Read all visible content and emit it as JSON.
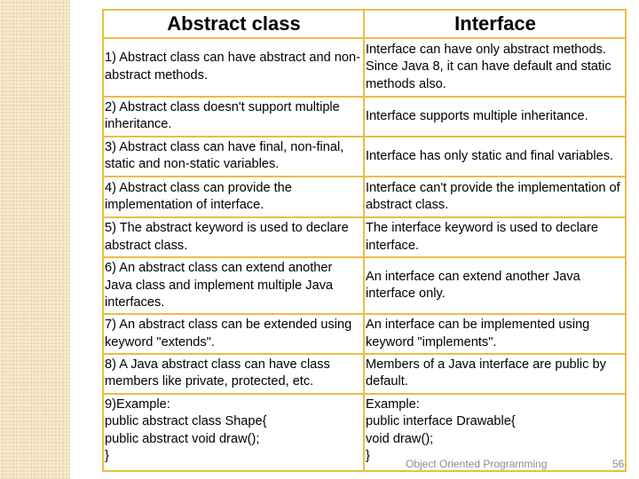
{
  "table": {
    "headers": [
      "Abstract class",
      "Interface"
    ],
    "rows": [
      {
        "abstract": "1) Abstract class can have abstract and non-abstract methods.",
        "interface": "Interface can have only abstract methods. Since Java 8, it can have default and static methods also."
      },
      {
        "abstract": "2) Abstract class doesn't support multiple inheritance.",
        "interface": "Interface supports multiple inheritance."
      },
      {
        "abstract": "3) Abstract class can have final, non-final, static and non-static variables.",
        "interface": "Interface has only static and final variables."
      },
      {
        "abstract": "4) Abstract class can provide the implementation of interface.",
        "interface": "Interface can't provide the implementation of abstract class."
      },
      {
        "abstract": "5) The abstract keyword is used to declare abstract class.",
        "interface": "The interface keyword is used to declare interface."
      },
      {
        "abstract": "6) An abstract class can extend another Java class and implement multiple Java interfaces.",
        "interface": "An interface can extend another Java interface only."
      },
      {
        "abstract": "7) An abstract class can be extended using keyword \"extends\".",
        "interface": "An interface can be implemented using keyword \"implements\"."
      },
      {
        "abstract": "8) A Java abstract class can have class members like private, protected, etc.",
        "interface": "Members of a Java interface are public by default."
      },
      {
        "abstract": "9)Example:\npublic abstract class Shape{\npublic abstract void draw();\n}",
        "interface": "Example:\npublic interface Drawable{\nvoid draw();\n}"
      }
    ]
  },
  "footer": {
    "text": "Object Oriented Programming",
    "slide_number": "56"
  },
  "colors": {
    "border": "#ebbd45",
    "side_band": "#f3e4c2"
  }
}
